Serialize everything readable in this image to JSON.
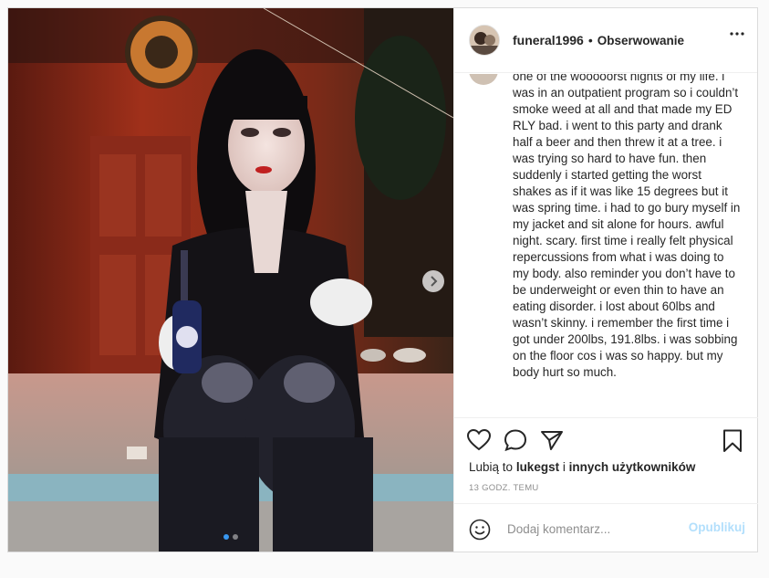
{
  "post": {
    "username": "funeral1996",
    "separator": "•",
    "follow_status": "Obserwowanie",
    "caption": "one of the wooooorst nights of my life. i was in an outpatient program so i couldn’t smoke weed at all and that made my ED RLY bad. i went to this party and drank half a beer and then threw it at a tree. i was trying so hard to have fun. then suddenly i started getting the worst shakes as if it was like 15 degrees but it was spring time. i had to go bury myself in my jacket and sit alone for hours. awful night. scary. first time i really felt physical repercussions from what i was doing to my body. also reminder you don’t have to be underweight or even thin to have an eating disorder. i lost about 60lbs and wasn’t skinny. i remember the first time i got under 200lbs, 191.8lbs. i was sobbing on the floor cos i was so happy. but my body hurt so much.",
    "likes": {
      "prefix": "Lubią to",
      "user": "lukegst",
      "joiner": "i",
      "rest": "innych użytkowników"
    },
    "timestamp": "13 GODZ. TEMU",
    "carousel": {
      "count": 2,
      "active": 1
    }
  },
  "comment_box": {
    "placeholder": "Dodaj komentarz...",
    "publish_label": "Opublikuj"
  },
  "icons": {
    "more": "more-options-icon",
    "like": "heart-icon",
    "comment": "comment-icon",
    "share": "share-icon",
    "save": "bookmark-icon",
    "emoji": "emoji-icon",
    "next": "chevron-right-icon"
  },
  "colors": {
    "link_blue": "#3897f0",
    "publish_disabled": "#b2dffc",
    "muted": "#8e8e8e"
  }
}
